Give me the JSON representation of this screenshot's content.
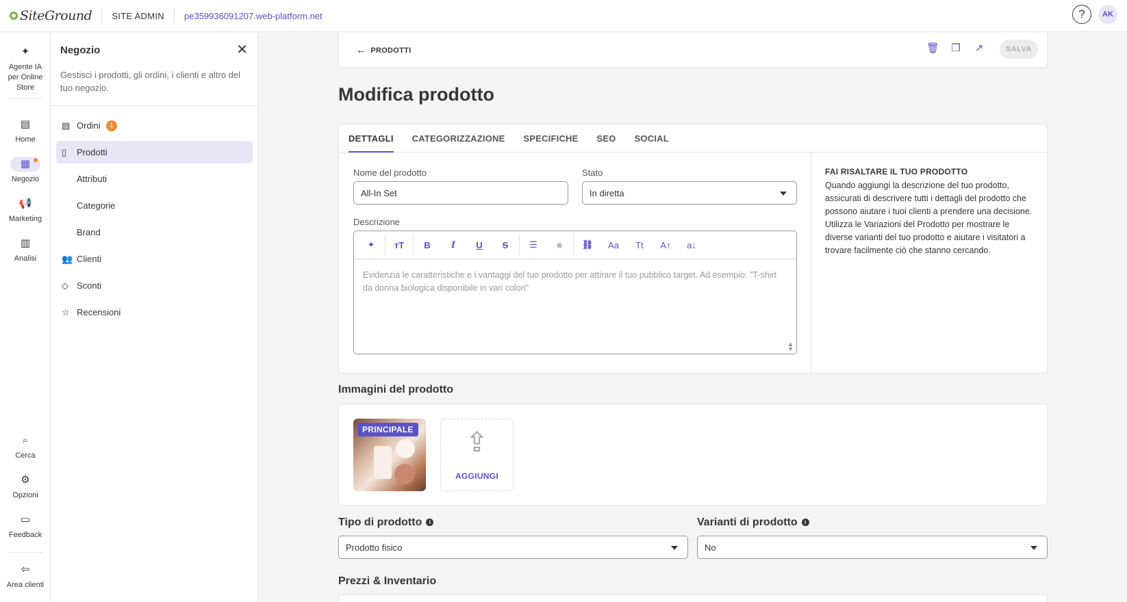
{
  "topbar": {
    "logo": "SiteGround",
    "section": "SITE ADMIN",
    "domain": "pe359936091207.web-platform.net",
    "help_icon": "question-circle-icon",
    "avatar": "AK"
  },
  "rail": {
    "items": [
      {
        "label": "Agente IA per Online Store",
        "icon": "sparkle-icon"
      },
      {
        "label": "Home",
        "icon": "home-icon"
      },
      {
        "label": "Negozio",
        "icon": "store-icon"
      },
      {
        "label": "Marketing",
        "icon": "megaphone-icon"
      },
      {
        "label": "Analisi",
        "icon": "chart-icon"
      },
      {
        "label": "Cerca",
        "icon": "search-icon"
      },
      {
        "label": "Opzioni",
        "icon": "gear-icon"
      },
      {
        "label": "Feedback",
        "icon": "feedback-icon"
      },
      {
        "label": "Area clienti",
        "icon": "logout-icon"
      }
    ]
  },
  "panel": {
    "title": "Negozio",
    "description": "Gestisci i prodotti, gli ordini, i clienti e altro del tuo negozio.",
    "items": [
      {
        "label": "Ordini",
        "badge": "1"
      },
      {
        "label": "Prodotti"
      },
      {
        "label": "Attributi"
      },
      {
        "label": "Categorie"
      },
      {
        "label": "Brand"
      },
      {
        "label": "Clienti"
      },
      {
        "label": "Sconti"
      },
      {
        "label": "Recensioni"
      }
    ]
  },
  "toolbar": {
    "back_label": "PRODOTTI",
    "save_label": "SALVA"
  },
  "page": {
    "title": "Modifica prodotto"
  },
  "tabs": [
    "DETTAGLI",
    "CATEGORIZZAZIONE",
    "SPECIFICHE",
    "SEO",
    "SOCIAL"
  ],
  "form": {
    "name_label": "Nome del prodotto",
    "name_value": "All-In Set",
    "status_label": "Stato",
    "status_value": "In diretta",
    "description_label": "Descrizione",
    "description_placeholder": "Evidenzia le caratteristiche e i vantaggi del tuo prodotto per attirare il tuo pubblico target. Ad esempio: \"T-shirt da donna biologica disponibile in vari colori\""
  },
  "editor_tools": [
    {
      "glyph": "✦",
      "icon": "ai-sparkle-icon"
    },
    {
      "glyph": "ᴛT",
      "icon": "text-size-icon"
    },
    {
      "glyph": "B",
      "icon": "bold-icon"
    },
    {
      "glyph": "I",
      "icon": "italic-icon"
    },
    {
      "glyph": "U",
      "icon": "underline-icon"
    },
    {
      "glyph": "S",
      "icon": "strikethrough-icon"
    },
    {
      "glyph": "☰",
      "icon": "bullet-list-icon"
    },
    {
      "glyph": "≡",
      "icon": "numbered-list-icon"
    },
    {
      "glyph": "⛓",
      "icon": "link-icon"
    },
    {
      "glyph": "Aa",
      "icon": "font-family-icon"
    },
    {
      "glyph": "Tt",
      "icon": "text-case-icon"
    },
    {
      "glyph": "A↑",
      "icon": "font-size-increase-icon"
    },
    {
      "glyph": "a↓",
      "icon": "font-size-decrease-icon"
    }
  ],
  "hint": {
    "title": "FAI RISALTARE IL TUO PRODOTTO",
    "text": "Quando aggiungi la descrizione del tuo prodotto, assicurati di descrivere tutti i dettagli del prodotto che possono aiutare i tuoi clienti a prendere una decisione. Utilizza le Variazioni del Prodotto per mostrare le diverse varianti del tuo prodotto e aiutare i visitatori a trovare facilmente ciò che stanno cercando."
  },
  "images": {
    "title": "Immagini del prodotto",
    "main_badge": "PRINCIPALE",
    "add_label": "AGGIUNGI"
  },
  "product_type": {
    "label": "Tipo di prodotto",
    "value": "Prodotto fisico"
  },
  "variants": {
    "label": "Varianti di prodotto",
    "value": "No"
  },
  "pricing": {
    "title": "Prezzi & Inventario"
  },
  "colors": {
    "accent": "#5c52c7",
    "badge": "#f28a38",
    "active_bg": "#e8e5f7"
  }
}
